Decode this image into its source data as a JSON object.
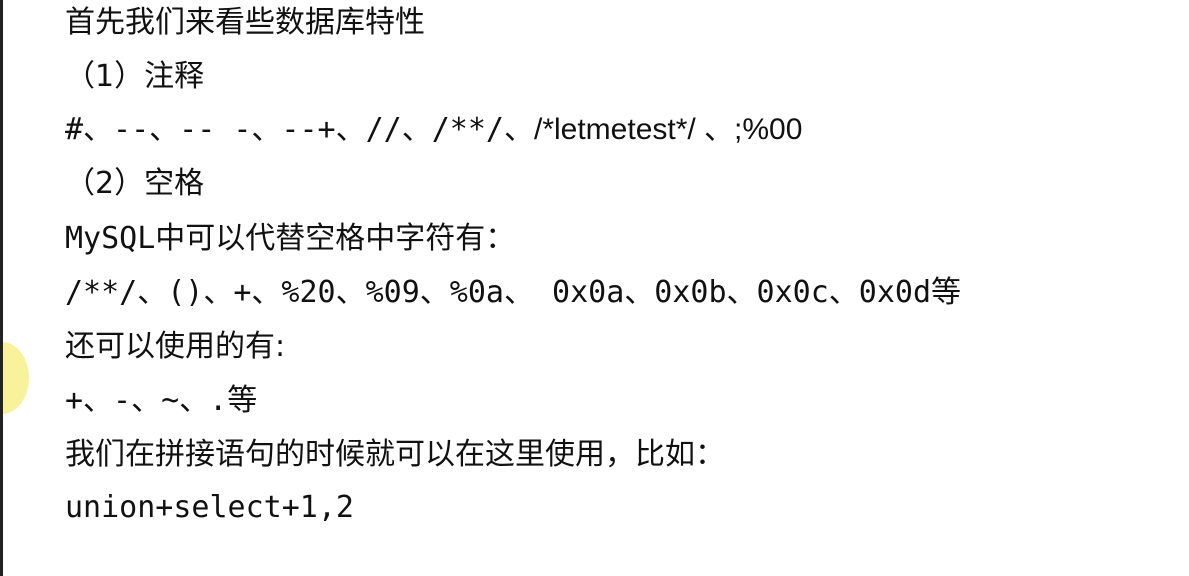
{
  "document": {
    "lines": {
      "intro": "首先我们来看些数据库特性",
      "section1_heading": "（1）注释",
      "comments_part1": "#、--、-- -、--+、//、/**/、",
      "comments_part2": "/*letmetest*/ 、;%00",
      "section2_heading": "（2）空格",
      "mysql_space_intro": "MySQL中可以代替空格中字符有：",
      "space_chars": "/**/、()、+、%20、%09、%0a、 0x0a、0x0b、0x0c、0x0d等",
      "also_usable_intro": "还可以使用的有:",
      "also_usable_chars": "+、-、~、.等",
      "concat_intro": "我们在拼接语句的时候就可以在这里使用，比如：",
      "example_query": "union+select+1,2"
    }
  },
  "colors": {
    "text": "#111111",
    "background": "#ffffff",
    "cursor_highlight": "#f6ef7a"
  }
}
